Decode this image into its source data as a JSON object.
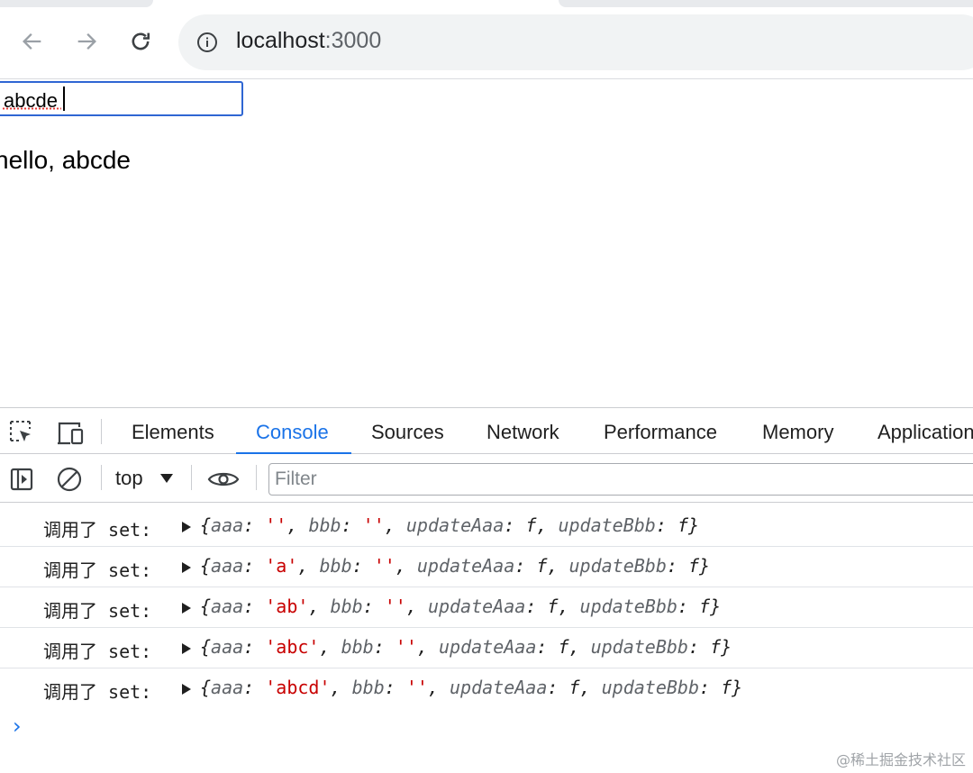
{
  "browser": {
    "url_host": "localhost",
    "url_port": ":3000"
  },
  "page": {
    "input_value": "abcde",
    "greeting": "hello, abcde"
  },
  "devtools": {
    "tabs": [
      "Elements",
      "Console",
      "Sources",
      "Network",
      "Performance",
      "Memory",
      "Application"
    ],
    "active_tab": "Console",
    "context": "top",
    "filter_placeholder": "Filter",
    "logs": [
      {
        "label": "调用了 set:",
        "aaa": "''",
        "bbb": "''"
      },
      {
        "label": "调用了 set:",
        "aaa": "'a'",
        "bbb": "''"
      },
      {
        "label": "调用了 set:",
        "aaa": "'ab'",
        "bbb": "''"
      },
      {
        "label": "调用了 set:",
        "aaa": "'abc'",
        "bbb": "''"
      },
      {
        "label": "调用了 set:",
        "aaa": "'abcd'",
        "bbb": "''"
      }
    ],
    "log_keys": {
      "aaa": "aaa",
      "bbb": "bbb",
      "updateAaa": "updateAaa",
      "updateBbb": "updateBbb",
      "fn": "f"
    }
  },
  "watermark": "@稀土掘金技术社区",
  "colors": {
    "accent": "#1a73e8",
    "string": "#c80000",
    "input_focus": "#2f66d3"
  }
}
